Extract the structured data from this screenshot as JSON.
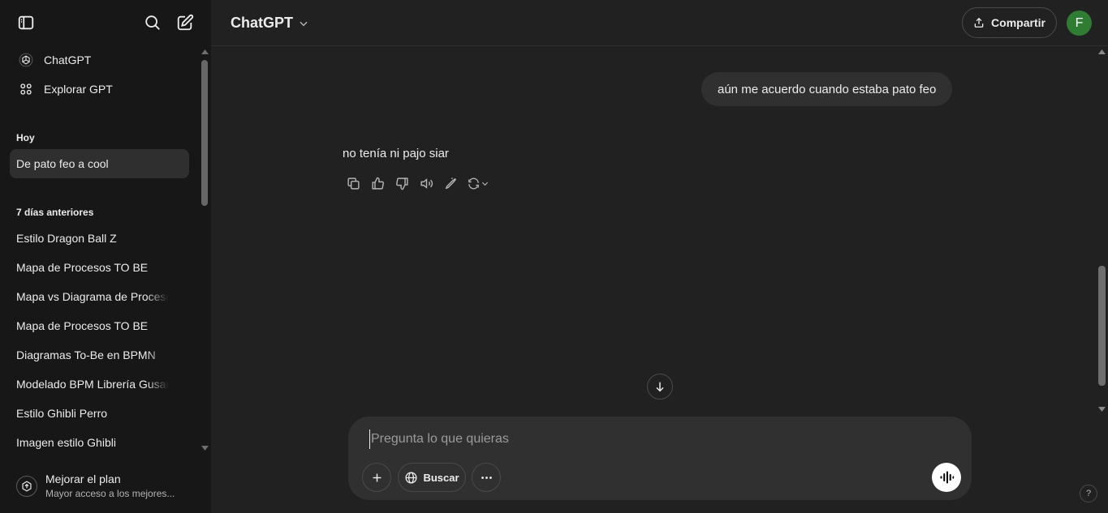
{
  "sidebar": {
    "top_icons": [
      "sidebar-toggle-icon",
      "search-icon",
      "new-chat-icon"
    ],
    "nav": [
      {
        "label": "ChatGPT",
        "icon": "openai-logo-icon"
      },
      {
        "label": "Explorar GPT",
        "icon": "grid-icon"
      }
    ],
    "sections": [
      {
        "heading": "Hoy",
        "items": [
          "De pato feo a cool"
        ]
      },
      {
        "heading": "7 días anteriores",
        "items": [
          "Estilo Dragon Ball Z",
          "Mapa de Procesos TO BE",
          "Mapa vs Diagrama de Procesos",
          "Mapa de Procesos TO BE",
          "Diagramas To-Be en BPMN",
          "Modelado BPM Librería Gusano",
          "Estilo Ghibli Perro",
          "Imagen estilo Ghibli"
        ]
      }
    ],
    "active_item": "De pato feo a cool",
    "footer": {
      "title": "Mejorar el plan",
      "subtitle": "Mayor acceso a los mejores..."
    }
  },
  "header": {
    "model": "ChatGPT",
    "share_label": "Compartir",
    "avatar_initial": "F",
    "avatar_color": "#2e7d32"
  },
  "conversation": {
    "user_message": "aún me acuerdo cuando estaba pato feo",
    "assistant_message": "no tenía ni pajo siar",
    "action_icons": [
      "copy-icon",
      "thumbs-up-icon",
      "thumbs-down-icon",
      "read-aloud-icon",
      "edit-canvas-icon",
      "regenerate-icon"
    ]
  },
  "composer": {
    "placeholder": "Pregunta lo que quieras",
    "value": "",
    "search_label": "Buscar"
  },
  "help_label": "?"
}
